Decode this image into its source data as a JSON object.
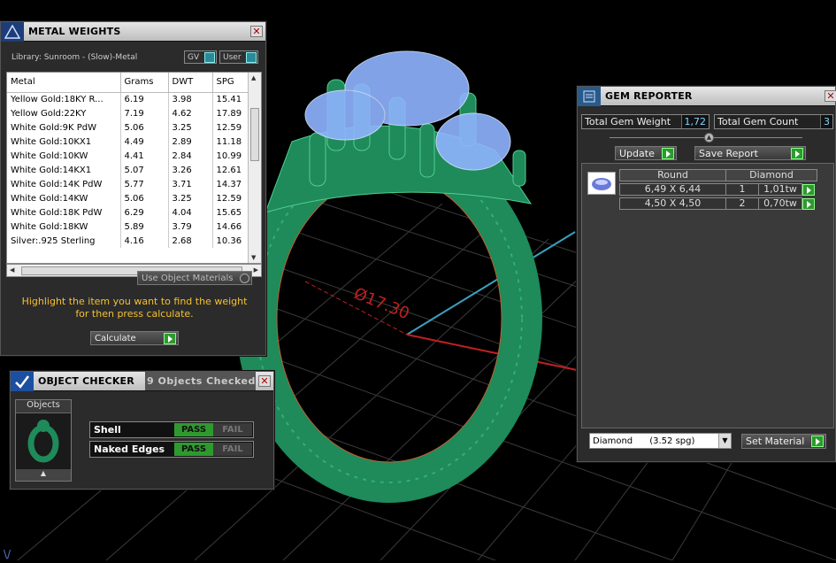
{
  "metal_weights": {
    "title": "METAL WEIGHTS",
    "library": "Library: Sunroom - (Slow)-Metal",
    "toggle_gv": "GV",
    "toggle_user": "User",
    "columns": [
      "Metal",
      "Grams",
      "DWT",
      "SPG"
    ],
    "rows": [
      [
        "Yellow Gold:18KY R...",
        "6.19",
        "3.98",
        "15.41"
      ],
      [
        "Yellow Gold:22KY",
        "7.19",
        "4.62",
        "17.89"
      ],
      [
        "White Gold:9K PdW",
        "5.06",
        "3.25",
        "12.59"
      ],
      [
        "White Gold:10KX1",
        "4.49",
        "2.89",
        "11.18"
      ],
      [
        "White Gold:10KW",
        "4.41",
        "2.84",
        "10.99"
      ],
      [
        "White Gold:14KX1",
        "5.07",
        "3.26",
        "12.61"
      ],
      [
        "White Gold:14K PdW",
        "5.77",
        "3.71",
        "14.37"
      ],
      [
        "White Gold:14KW",
        "5.06",
        "3.25",
        "12.59"
      ],
      [
        "White Gold:18K PdW",
        "6.29",
        "4.04",
        "15.65"
      ],
      [
        "White Gold:18KW",
        "5.89",
        "3.79",
        "14.66"
      ],
      [
        "Silver:.925 Sterling",
        "4.16",
        "2.68",
        "10.36"
      ]
    ],
    "use_object_materials": "Use Object Materials",
    "hint_line1": "Highlight the item you want to find the weight",
    "hint_line2": "for then press calculate.",
    "calculate_label": "Calculate"
  },
  "object_checker": {
    "title": "OBJECT CHECKER",
    "count_text": "9  Objects Checked",
    "objects_label": "Objects",
    "checks": [
      {
        "name": "Shell",
        "pass": "PASS",
        "fail": "FAIL"
      },
      {
        "name": "Naked Edges",
        "pass": "PASS",
        "fail": "FAIL"
      }
    ]
  },
  "gem_reporter": {
    "title": "GEM REPORTER",
    "total_weight_label": "Total Gem Weight",
    "total_weight_value": "1,72",
    "total_count_label": "Total Gem Count",
    "total_count_value": "3",
    "update_label": "Update",
    "save_report_label": "Save Report",
    "headers": [
      "Round",
      "Diamond"
    ],
    "gems": [
      {
        "size": "6,49 X 6,44",
        "qty": "1",
        "weight": "1,01tw"
      },
      {
        "size": "4,50 X 4,50",
        "qty": "2",
        "weight": "0,70tw"
      }
    ],
    "material_select": "Diamond      (3.52 spg)",
    "set_material_label": "Set Material"
  },
  "viewport": {
    "dimension_label": "Ø17.30"
  },
  "colors": {
    "ring_green": "#1f8a5a",
    "gem_blue": "#8fb4ff",
    "hint_yellow": "#f5c030",
    "pass_green": "#2e9a2e"
  }
}
